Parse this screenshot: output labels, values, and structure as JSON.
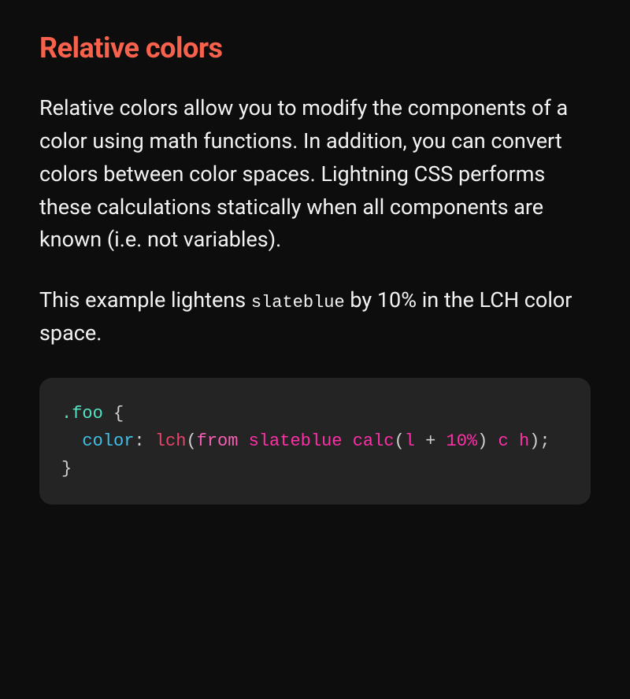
{
  "heading": "Relative colors",
  "para1": "Relative colors allow you to modify the components of a color using math functions. In addition, you can convert colors between color spaces. Lightning CSS performs these calculations statically when all components are known (i.e. not variables).",
  "para2_pre": "This example lightens ",
  "para2_code": "slateblue",
  "para2_post": " by 10% in the LCH color space.",
  "code": {
    "selector": ".foo",
    "brace_open": " {",
    "indent": "  ",
    "prop": "color",
    "colon": ": ",
    "fn_lch": "lch",
    "paren_open": "(",
    "kw_from": "from",
    "space": " ",
    "val_slateblue": "slateblue",
    "fn_calc": "calc",
    "paren_open2": "(",
    "val_l": "l",
    "plus": " + ",
    "val_10pct": "10%",
    "paren_close2": ")",
    "val_c": "c",
    "val_h": "h",
    "paren_close": ")",
    "semicolon": ";",
    "brace_close": "}"
  }
}
